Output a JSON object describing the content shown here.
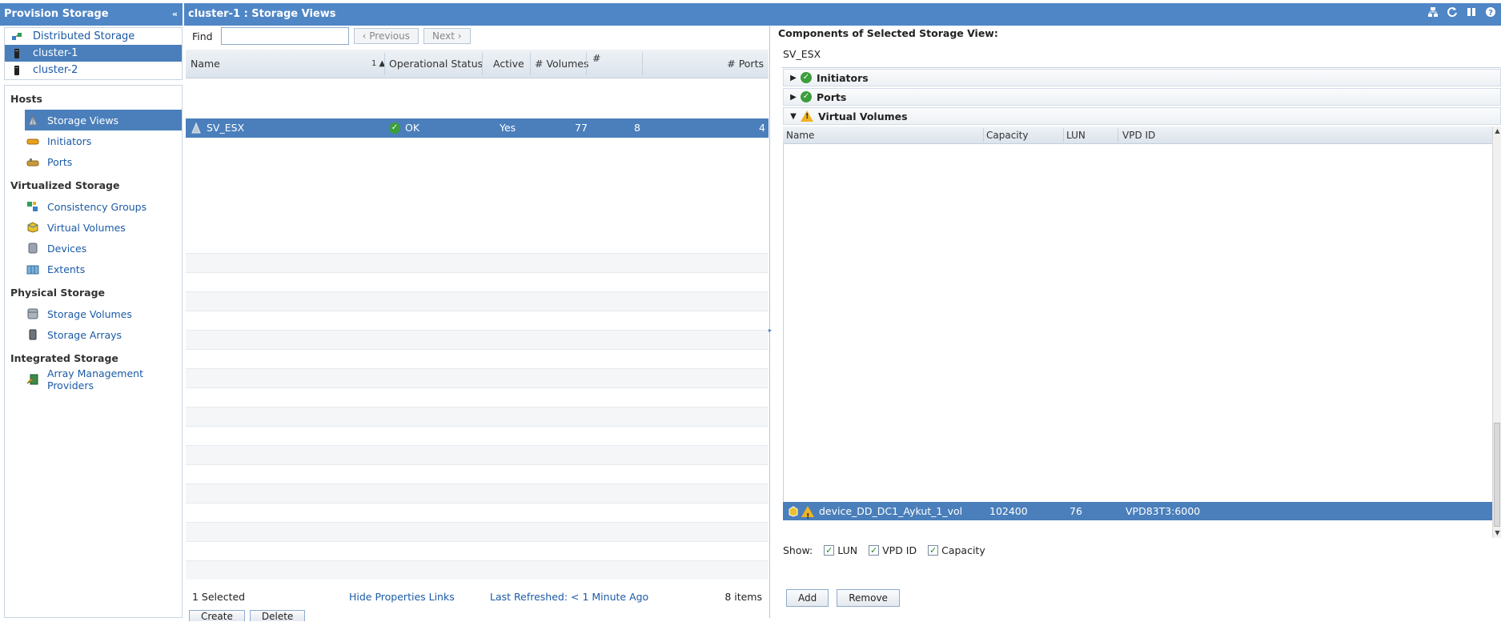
{
  "left": {
    "header_title": "Provision Storage",
    "collapse_glyph": "‹‹",
    "clusters": [
      {
        "label": "Distributed Storage",
        "icon": "distributed-storage-icon",
        "selected": false
      },
      {
        "label": "cluster-1",
        "icon": "cluster-icon",
        "selected": true
      },
      {
        "label": "cluster-2",
        "icon": "cluster-icon",
        "selected": false
      }
    ],
    "nav": [
      {
        "category": "Hosts",
        "items": [
          {
            "label": "Storage Views",
            "icon": "storage-views-icon",
            "selected": true
          },
          {
            "label": "Initiators",
            "icon": "initiators-icon",
            "selected": false
          },
          {
            "label": "Ports",
            "icon": "ports-icon",
            "selected": false
          }
        ]
      },
      {
        "category": "Virtualized Storage",
        "items": [
          {
            "label": "Consistency Groups",
            "icon": "consistency-groups-icon",
            "selected": false
          },
          {
            "label": "Virtual Volumes",
            "icon": "virtual-volumes-icon",
            "selected": false
          },
          {
            "label": "Devices",
            "icon": "devices-icon",
            "selected": false
          },
          {
            "label": "Extents",
            "icon": "extents-icon",
            "selected": false
          }
        ]
      },
      {
        "category": "Physical Storage",
        "items": [
          {
            "label": "Storage Volumes",
            "icon": "storage-volumes-icon",
            "selected": false
          },
          {
            "label": "Storage Arrays",
            "icon": "storage-arrays-icon",
            "selected": false
          }
        ]
      },
      {
        "category": "Integrated Storage",
        "items": [
          {
            "label": "Array Management Providers",
            "icon": "array-management-providers-icon",
            "selected": false
          }
        ]
      }
    ]
  },
  "middle": {
    "header_title": "cluster-1 : Storage Views",
    "find_label": "Find",
    "find_value": "",
    "prev_label": "Previous",
    "next_label": "Next",
    "columns": {
      "name": "Name",
      "sort_indicator": "1 ▲",
      "status": "Operational Status",
      "active": "Active",
      "volumes": "# Volumes",
      "hash": "#",
      "ports": "# Ports"
    },
    "row": {
      "name": "SV_ESX",
      "status": "OK",
      "active": "Yes",
      "volumes": "77",
      "initiators": "8",
      "ports": "4"
    },
    "footer": {
      "selected": "1 Selected",
      "hide_props": "Hide Properties Links",
      "last_refreshed": "Last Refreshed: < 1 Minute Ago",
      "items": "8 items"
    },
    "buttons": {
      "create": "Create",
      "delete": "Delete"
    }
  },
  "right": {
    "title": "Components of Selected Storage View:",
    "view_name": "SV_ESX",
    "sections": {
      "initiators": "Initiators",
      "ports": "Ports",
      "virtual_volumes": "Virtual Volumes"
    },
    "columns": {
      "name": "Name",
      "capacity": "Capacity",
      "lun": "LUN",
      "vpd": "VPD ID"
    },
    "row": {
      "name": "device_DD_DC1_Aykut_1_vol",
      "capacity": "102400",
      "lun": "76",
      "vpd": "VPD83T3:6000"
    },
    "show": {
      "label": "Show:",
      "lun": "LUN",
      "vpd": "VPD ID",
      "capacity": "Capacity"
    },
    "buttons": {
      "add": "Add",
      "remove": "Remove"
    }
  },
  "colors": {
    "accent": "#4f86c6",
    "selection": "#4a7fbb",
    "ok": "#3c9e3c",
    "warning": "#f0b323",
    "link": "#1b5aa6"
  }
}
